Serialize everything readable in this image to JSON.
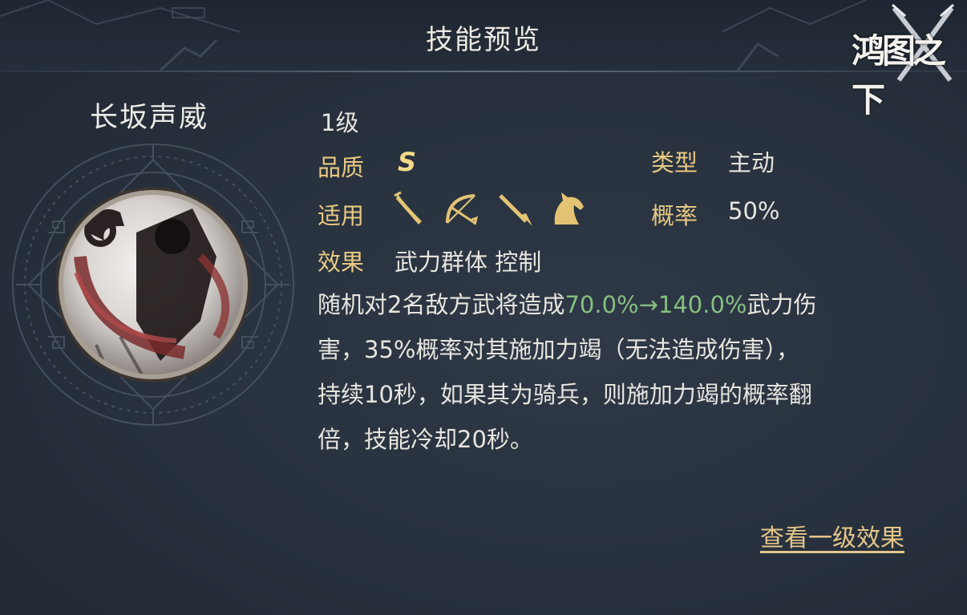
{
  "header": {
    "title": "技能预览",
    "logo_text": "鸿图之下"
  },
  "skill": {
    "name": "长坂声威",
    "level": "1级",
    "quality_label": "品质",
    "quality_value": "S",
    "type_label": "类型",
    "type_value": "主动",
    "applicable_label": "适用",
    "applicable_units": [
      "sword-icon",
      "bow-icon",
      "spear-icon",
      "horse-icon"
    ],
    "chance_label": "概率",
    "chance_value": "50%",
    "effect_label": "效果",
    "effect_value": "武力群体 控制"
  },
  "description": {
    "line1_a": "随机对2名敌方武将造成",
    "line1_highlight": "70.0%→140.0%",
    "line1_b": "武力伤",
    "line2": "害，35%概率对其施加力竭（无法造成伤害），",
    "line3": "持续10秒，如果其为骑兵，则施加力竭的概率翻",
    "line4": "倍，技能冷却20秒。"
  },
  "actions": {
    "view_level1": "查看一级效果"
  },
  "colors": {
    "label_gold": "#e8c983",
    "highlight_green": "#86bf82",
    "background": "#28313d"
  }
}
